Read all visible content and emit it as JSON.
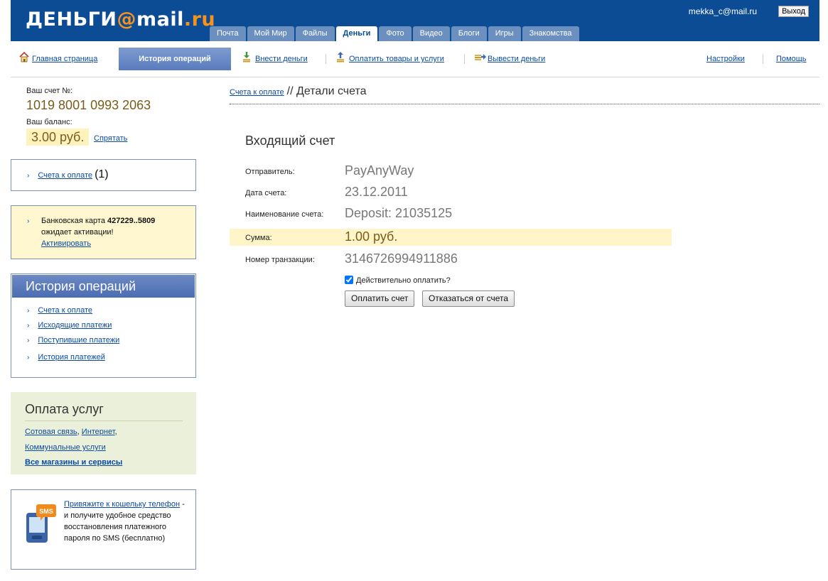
{
  "header": {
    "logo_text": "ДЕНЬГИ",
    "logo_at": "@",
    "logo_mail": "mail",
    "logo_dot": ".",
    "logo_ru": "ru",
    "user_email": "mekka_c@mail.ru",
    "logout_label": "Выход",
    "tabs": [
      "Почта",
      "Мой Мир",
      "Файлы",
      "Деньги",
      "Фото",
      "Видео",
      "Блоги",
      "Игры",
      "Знакомства"
    ],
    "active_tab": "Деньги"
  },
  "nav": {
    "home": "Главная страница",
    "history": "История операций",
    "deposit": "Внести деньги",
    "pay": "Оплатить товары и услуги",
    "withdraw": "Вывести деньги",
    "settings": "Настройки",
    "help": "Помощь"
  },
  "account": {
    "number_label": "Ваш счет №:",
    "number": "1019 8001 0993 2063",
    "balance_label": "Ваш баланс:",
    "balance": "3.00 руб.",
    "hide_label": "Спрятать"
  },
  "invoices_box": {
    "link": "Счета к оплате",
    "count": "(1)"
  },
  "card_box": {
    "prefix": "Банковская карта ",
    "card": "427229..5809",
    "line2": "ожидает активации!",
    "link": "Активировать"
  },
  "history_box": {
    "title": "История операций",
    "items": [
      "Счета к оплате",
      "Исходящие платежи",
      "Поступившие платежи",
      "История платежей"
    ]
  },
  "services_box": {
    "title": "Оплата услуг",
    "mobile": "Сотовая связь",
    "internet": "Интернет",
    "utilities": "Коммунальные услуги",
    "all": "Все магазины и сервисы"
  },
  "sms_box": {
    "badge": "SMS",
    "link": "Привяжите к кошельку телефон",
    "text": " - и получите удобное средство восстановления платежного пароля по SMS (бесплатно)"
  },
  "main": {
    "breadcrumb_link": "Счета к оплате",
    "breadcrumb_current": "// Детали счета",
    "heading": "Входящий счет",
    "sender_label": "Отправитель:",
    "sender": "PayAnyWay",
    "date_label": "Дата счета:",
    "date": "23.12.2011",
    "name_label": "Наименование счета:",
    "name": "Deposit: 21035125",
    "sum_label": "Сумма:",
    "sum": "1.00 руб.",
    "txn_label": "Номер транзакции:",
    "txn": "3146726994911886",
    "confirm_label": "Действительно оплатить?",
    "confirm_checked": true,
    "pay_button": "Оплатить счет",
    "decline_button": "Отказаться от счета"
  },
  "colors": {
    "header_bg": "#0b4c94",
    "accent_orange": "#f7921e",
    "highlight": "#fff5c8"
  }
}
